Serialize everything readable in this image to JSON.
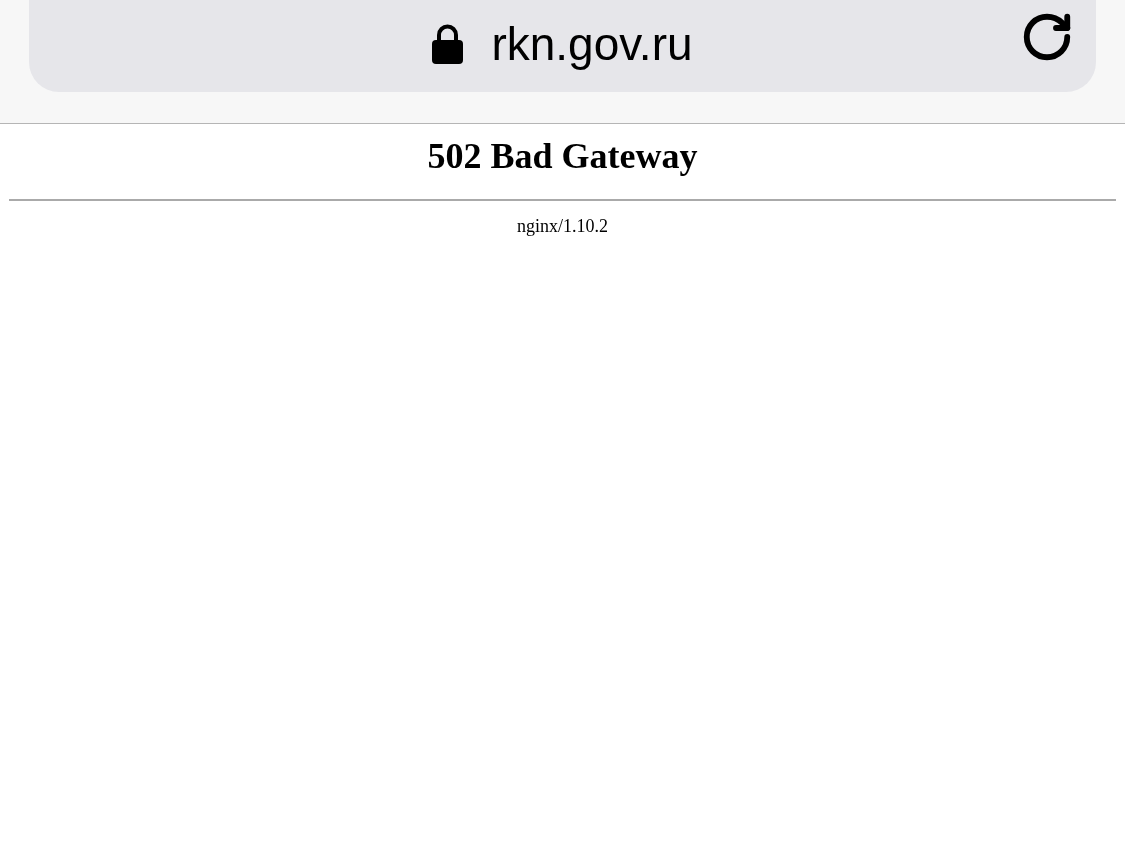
{
  "address_bar": {
    "url": "rkn.gov.ru",
    "secure": true
  },
  "page": {
    "heading": "502 Bad Gateway",
    "footer": "nginx/1.10.2"
  }
}
